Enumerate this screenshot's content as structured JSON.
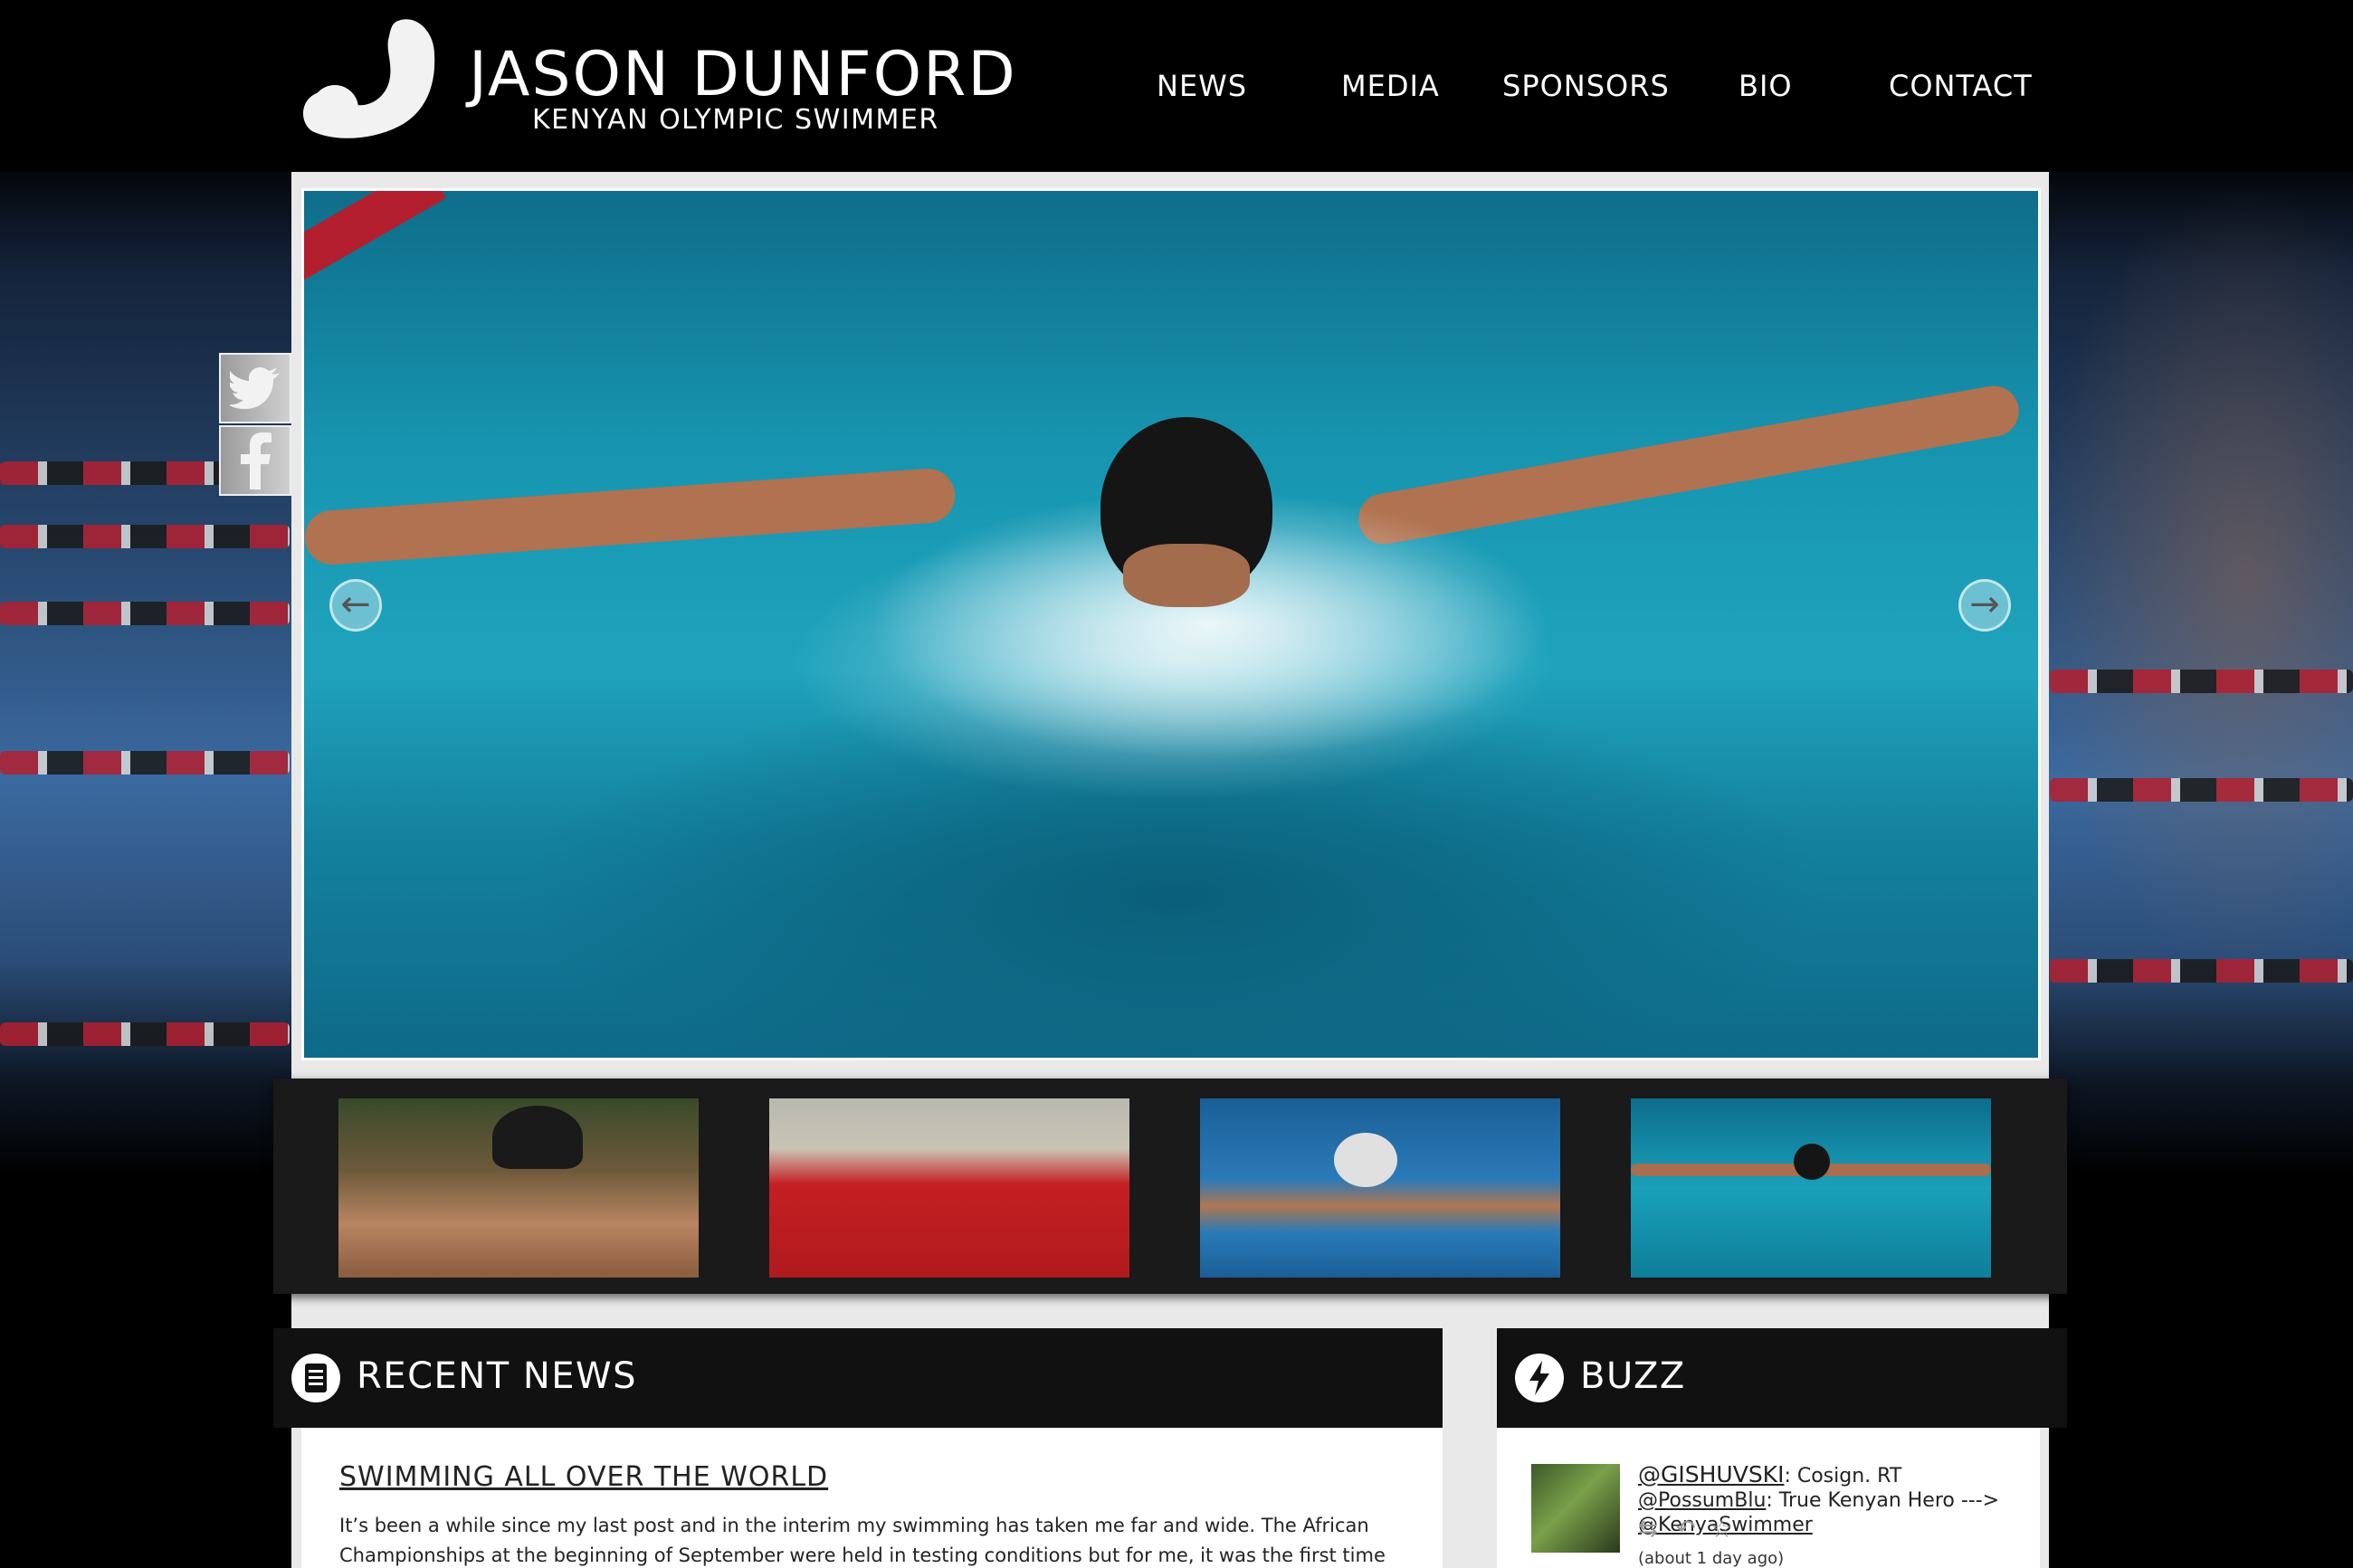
{
  "brand": {
    "name": "JASON DUNFORD",
    "tagline": "KENYAN OLYMPIC SWIMMER"
  },
  "nav": {
    "items": [
      "NEWS",
      "MEDIA",
      "SPONSORS",
      "BIO",
      "CONTACT"
    ]
  },
  "slider": {
    "prev_icon": "arrow-left-icon",
    "next_icon": "arrow-right-icon"
  },
  "social": {
    "twitter_icon": "twitter-icon",
    "facebook_icon": "facebook-icon"
  },
  "recent_news": {
    "heading": "RECENT NEWS",
    "icon": "notepad-icon",
    "post_title": "SWIMMING ALL OVER THE WORLD",
    "post_excerpt": "It’s been a while since my last post and in the interim my swimming has taken me far and wide. The African Championships at the beginning of September were held in testing conditions but for me, it was the first time […]"
  },
  "buzz": {
    "heading": "BUZZ",
    "icon": "lightning-icon",
    "tweet": {
      "user": "@GISHUVSKI",
      "text_1": ": Cosign. RT ",
      "mention_1": "@PossumBlu",
      "text_2": ": True Kenyan Hero ---> ",
      "mention_2": "@KenyaSwimmer",
      "time": "(about 1 day ago)"
    }
  },
  "colors": {
    "background": "#000000",
    "panel_header": "#111111",
    "frame": "#e9e9e9",
    "pool_blue": "#1fa3bd",
    "lane_red": "#b31f2f"
  }
}
